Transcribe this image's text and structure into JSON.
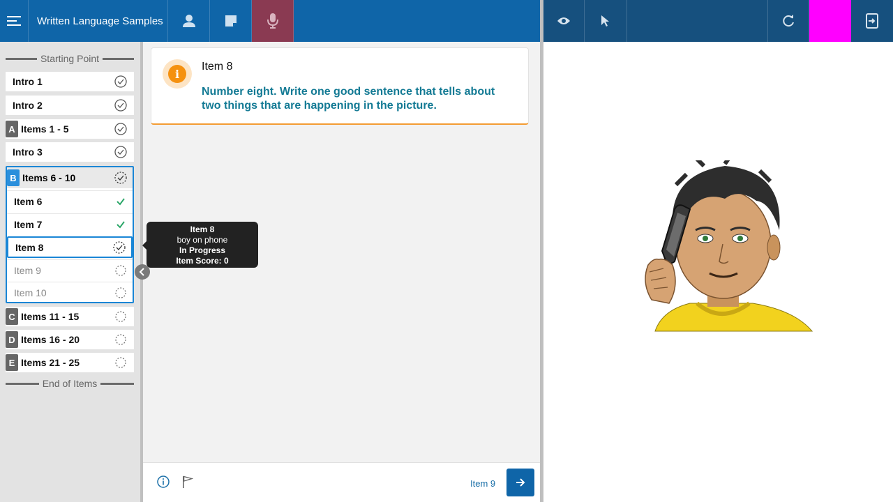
{
  "header": {
    "title": "Written Language Samples",
    "menu_icon": "hamburger-icon",
    "icons": [
      "person-icon",
      "note-icon",
      "microphone-icon"
    ],
    "right_icons": [
      "eye-icon",
      "pointer-icon",
      "refresh-icon",
      "exit-icon"
    ],
    "accent_block_color": "#ff00ff"
  },
  "sidebar": {
    "start_label": "Starting Point",
    "end_label": "End of Items",
    "items": [
      {
        "badge": "",
        "label": "Intro 1",
        "status": "complete"
      },
      {
        "badge": "",
        "label": "Intro 2",
        "status": "complete"
      },
      {
        "badge": "A",
        "label": "Items 1 - 5",
        "status": "complete"
      },
      {
        "badge": "",
        "label": "Intro 3",
        "status": "complete"
      }
    ],
    "group": {
      "badge": "B",
      "label": "Items 6 - 10",
      "status": "in-progress",
      "items": [
        {
          "label": "Item 6",
          "status": "scored"
        },
        {
          "label": "Item 7",
          "status": "scored"
        },
        {
          "label": "Item 8",
          "status": "in-progress"
        },
        {
          "label": "Item 9",
          "status": "not-started"
        },
        {
          "label": "Item 10",
          "status": "not-started"
        }
      ]
    },
    "later_items": [
      {
        "badge": "C",
        "label": "Items 11 - 15",
        "status": "not-started"
      },
      {
        "badge": "D",
        "label": "Items 16 - 20",
        "status": "not-started"
      },
      {
        "badge": "E",
        "label": "Items 21 - 25",
        "status": "not-started"
      }
    ]
  },
  "tooltip": {
    "title": "Item 8",
    "desc": "boy on phone",
    "status": "In Progress",
    "score": "Item Score: 0"
  },
  "card": {
    "title": "Item 8",
    "instruction": "Number eight. Write one good sentence that tells about two things that are happening in the picture."
  },
  "footer": {
    "next_label": "Item 9"
  },
  "stimulus": {
    "description_icon": "boy-on-phone-illustration"
  }
}
